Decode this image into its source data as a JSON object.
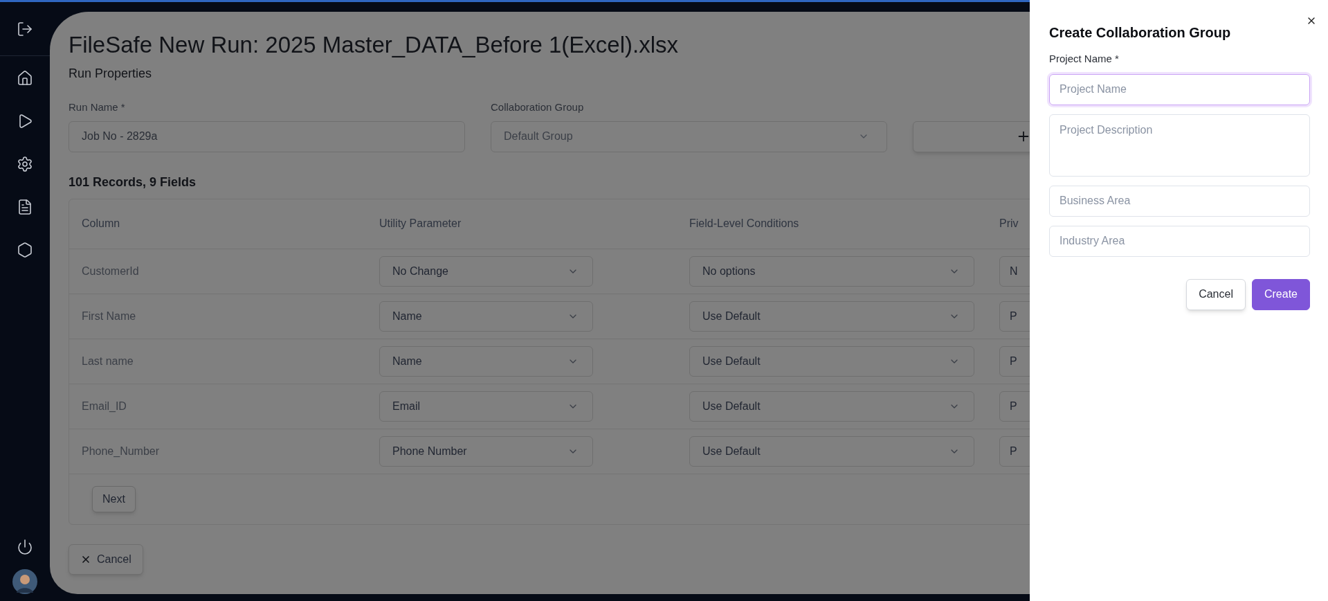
{
  "sidebar": {
    "items": [
      {
        "kind": "logout"
      },
      {
        "kind": "home"
      },
      {
        "kind": "run"
      },
      {
        "kind": "settings"
      },
      {
        "kind": "document"
      },
      {
        "kind": "hexagon"
      }
    ],
    "bottom_items": [
      {
        "kind": "power"
      },
      {
        "kind": "avatar"
      }
    ]
  },
  "page": {
    "title": "FileSafe New Run: 2025 Master_DATA_Before 1(Excel).xlsx",
    "section": "Run Properties",
    "run_name": {
      "label": "Run Name *",
      "value": "Job No - 2829a"
    },
    "collaboration_group": {
      "label": "Collaboration Group",
      "value": "Default Group"
    },
    "summary": "101 Records, 9 Fields",
    "table": {
      "columns": [
        "Column",
        "Utility Parameter",
        "Field-Level Conditions",
        "Priv"
      ],
      "rows": [
        {
          "column": "CustomerId",
          "utility": "No Change",
          "condition": "No options",
          "column_4": "N"
        },
        {
          "column": "First Name",
          "utility": "Name",
          "condition": "Use Default",
          "column_4": "P"
        },
        {
          "column": "Last name",
          "utility": "Name",
          "condition": "Use Default",
          "column_4": "P"
        },
        {
          "column": "Email_ID",
          "utility": "Email",
          "condition": "Use Default",
          "column_4": "P"
        },
        {
          "column": "Phone_Number",
          "utility": "Phone Number",
          "condition": "Use Default",
          "column_4": "P"
        }
      ],
      "next_button": "Next"
    },
    "cancel_button": "Cancel"
  },
  "drawer": {
    "title": "Create Collaboration Group",
    "project_name_label": "Project Name *",
    "fields": [
      {
        "kind": "input",
        "placeholder": "Project Name",
        "focused": true
      },
      {
        "kind": "textarea",
        "placeholder": "Project Description",
        "focused": false
      },
      {
        "kind": "input",
        "placeholder": "Business Area",
        "focused": false
      },
      {
        "kind": "input",
        "placeholder": "Industry Area",
        "focused": false
      }
    ],
    "buttons": [
      {
        "label": "Cancel",
        "kind": "secondary"
      },
      {
        "label": "Create",
        "kind": "primary"
      }
    ]
  }
}
